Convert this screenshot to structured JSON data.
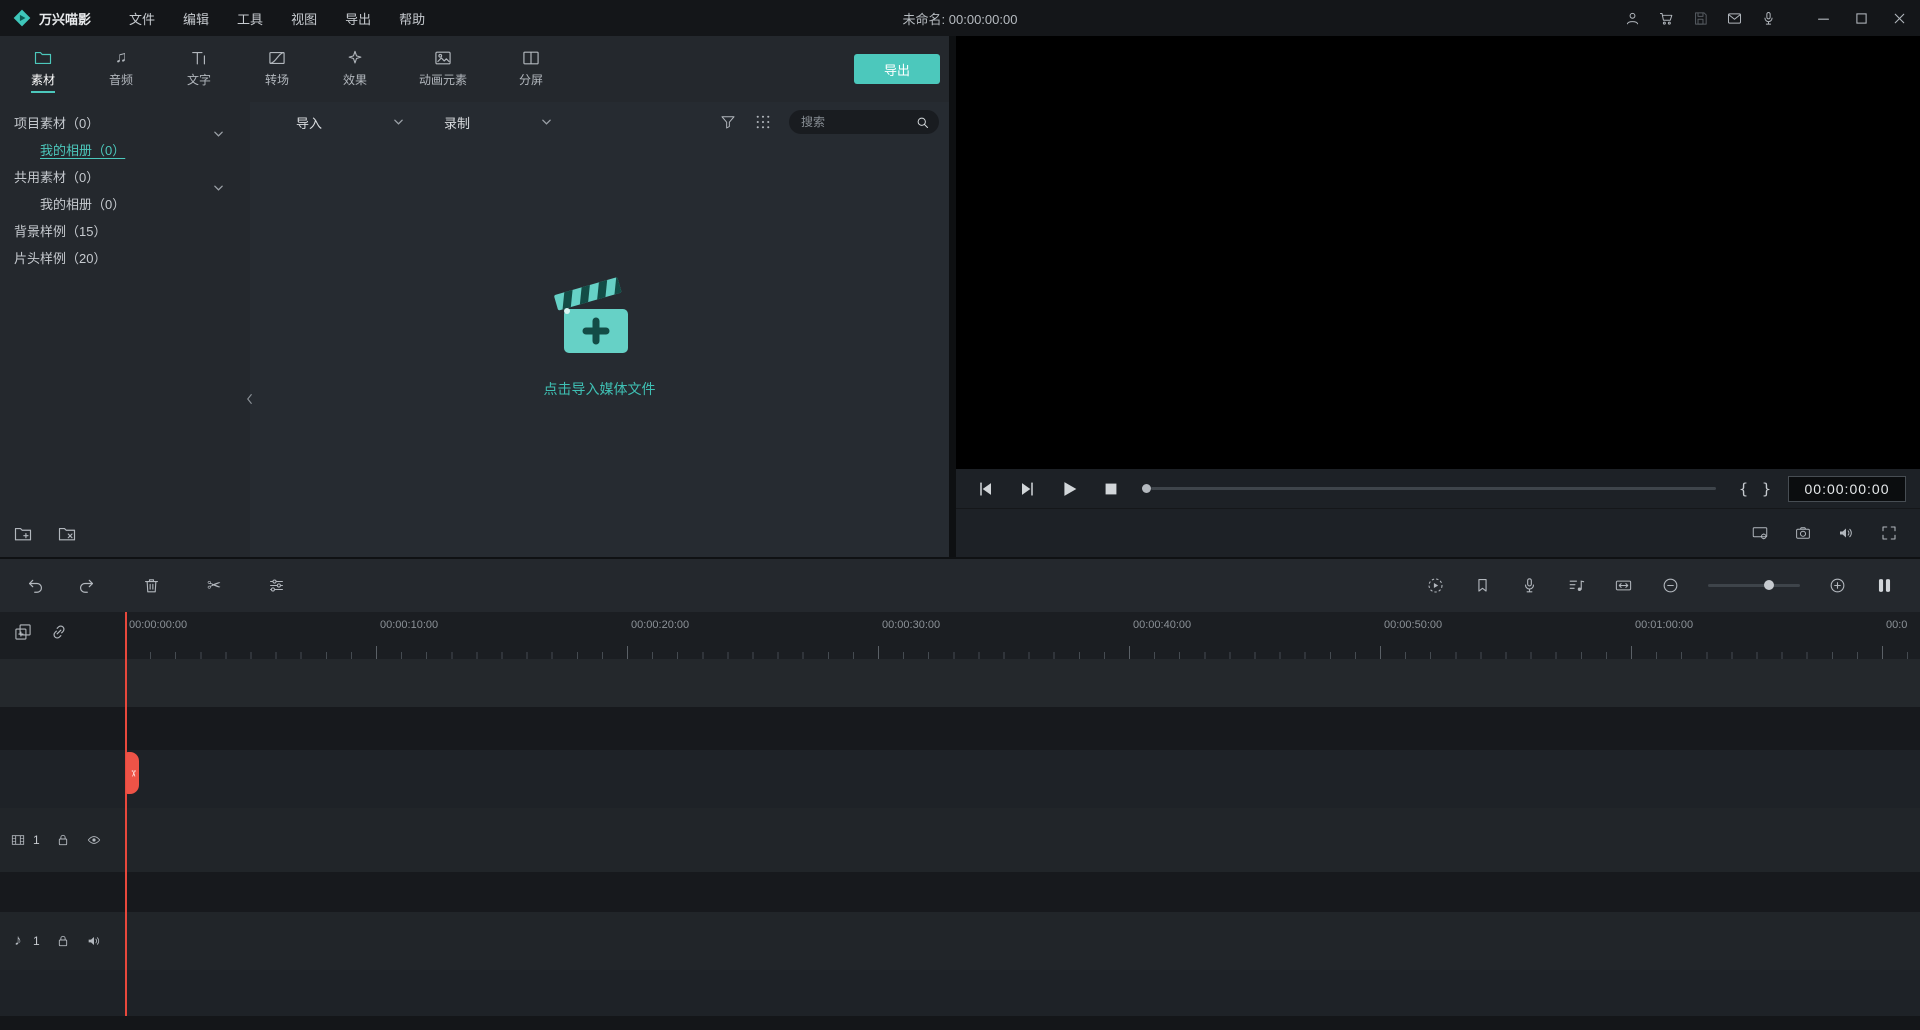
{
  "titlebar": {
    "app_name": "万兴喵影",
    "menus": [
      "文件",
      "编辑",
      "工具",
      "视图",
      "导出",
      "帮助"
    ],
    "document_title": "未命名: 00:00:00:00"
  },
  "tabbar": {
    "tabs": [
      {
        "label": "素材",
        "active": true
      },
      {
        "label": "音频",
        "active": false
      },
      {
        "label": "文字",
        "active": false
      },
      {
        "label": "转场",
        "active": false
      },
      {
        "label": "效果",
        "active": false
      },
      {
        "label": "动画元素",
        "active": false
      },
      {
        "label": "分屏",
        "active": false
      }
    ],
    "export_label": "导出"
  },
  "sidebar": {
    "items": [
      {
        "label": "项目素材（0）",
        "level": 0,
        "chevron": true,
        "selected": false
      },
      {
        "label": "我的相册（0）",
        "level": 1,
        "chevron": false,
        "selected": true
      },
      {
        "label": "共用素材（0）",
        "level": 0,
        "chevron": true,
        "selected": false
      },
      {
        "label": "我的相册（0）",
        "level": 1,
        "chevron": false,
        "selected": false
      },
      {
        "label": "背景样例（15）",
        "level": 0,
        "chevron": false,
        "selected": false
      },
      {
        "label": "片头样例（20）",
        "level": 0,
        "chevron": false,
        "selected": false
      }
    ]
  },
  "media": {
    "import_label": "导入",
    "record_label": "录制",
    "search_placeholder": "搜索",
    "search_value": "",
    "empty_text": "点击导入媒体文件"
  },
  "preview": {
    "timecode": "00:00:00:00"
  },
  "timeline": {
    "ruler_labels": [
      "00:00:00:00",
      "00:00:10:00",
      "00:00:20:00",
      "00:00:30:00",
      "00:00:40:00",
      "00:00:50:00",
      "00:01:00:00",
      "00:0"
    ],
    "video_track_number": "1",
    "audio_track_number": "1"
  },
  "colors": {
    "accent": "#4cc8bc",
    "playhead": "#ee5347"
  }
}
